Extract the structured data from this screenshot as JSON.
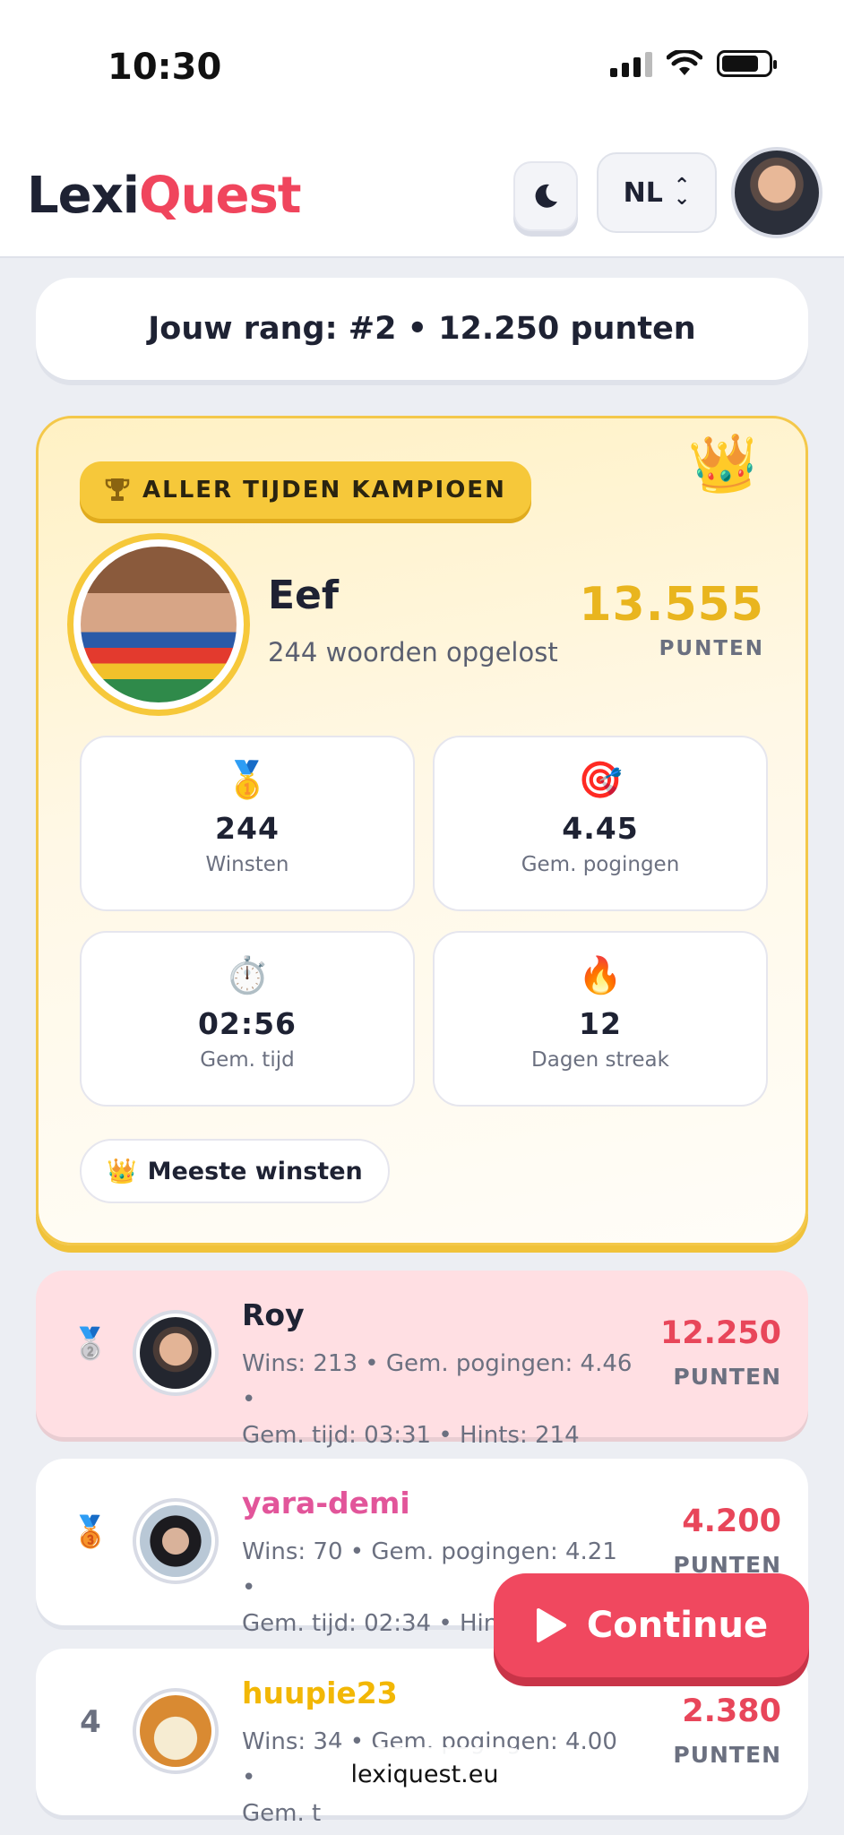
{
  "status_bar": {
    "time": "10:30"
  },
  "header": {
    "logo_part1": "Lexi",
    "logo_part2": "Quest",
    "language": "NL",
    "colors": {
      "brand_dark": "#1e2233",
      "brand_accent": "#f0455d"
    }
  },
  "rank_summary": "Jouw rang: #2 • 12.250 punten",
  "champion": {
    "badge_label": "ALLER TIJDEN KAMPIOEN",
    "badge_icon": "trophy-icon",
    "name": "Eef",
    "solved": "244 woorden opgelost",
    "points": "13.555",
    "points_label": "PUNTEN",
    "stats": [
      {
        "icon": "🥇",
        "value": "244",
        "label": "Winsten"
      },
      {
        "icon": "🎯",
        "value": "4.45",
        "label": "Gem. pogingen"
      },
      {
        "icon": "⏱️",
        "value": "02:56",
        "label": "Gem. tijd"
      },
      {
        "icon": "🔥",
        "value": "12",
        "label": "Dagen streak"
      }
    ],
    "most_wins_icon": "👑",
    "most_wins_label": "Meeste winsten",
    "crown_icon": "👑"
  },
  "leaderboard": [
    {
      "rank_icon": "🥈",
      "name": "Roy",
      "name_color": "#1e2233",
      "stats_line1": "Wins: 213 • Gem. pogingen: 4.46 •",
      "stats_line2": "Gem. tijd: 03:31 • Hints: 214",
      "points": "12.250",
      "points_label": "PUNTEN",
      "is_current_user": true
    },
    {
      "rank_icon": "🥉",
      "name": "yara-demi",
      "name_color": "#e2559a",
      "stats_line1": "Wins: 70 • Gem. pogingen: 4.21 •",
      "stats_line2": "Gem. tijd: 02:34 • Hints:",
      "points": "4.200",
      "points_label": "PUNTEN",
      "is_current_user": false
    },
    {
      "rank": "4",
      "name": "huupie23",
      "name_color": "#f2b705",
      "stats_line1": "Wins: 34 • Gem. pogingen: 4.00 •",
      "stats_line2": "Gem. t",
      "points": "2.380",
      "points_label": "PUNTEN",
      "is_current_user": false
    }
  ],
  "continue_button": {
    "label": "Continue",
    "icon": "play-icon"
  },
  "browser": {
    "url": "lexiquest.eu"
  }
}
